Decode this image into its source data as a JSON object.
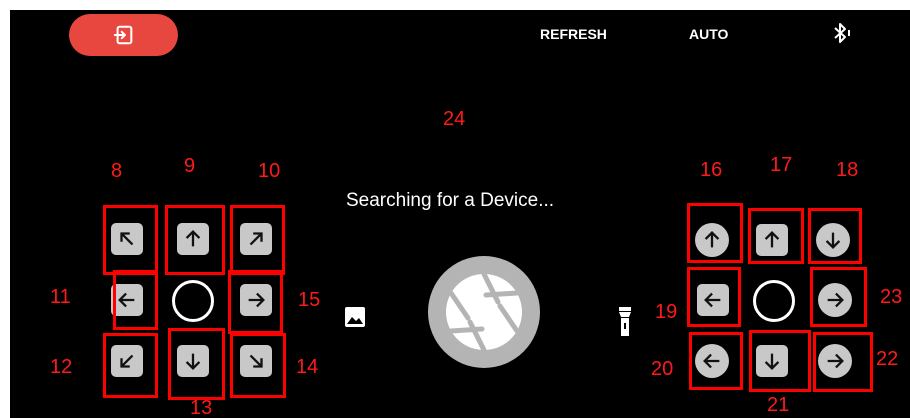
{
  "toolbar": {
    "exit_icon": "exit-icon",
    "refresh_label": "REFRESH",
    "auto_label": "AUTO",
    "bluetooth_icon": "bluetooth-icon"
  },
  "status": {
    "text": "Searching for a Device..."
  },
  "annotations": {
    "n8": "8",
    "n9": "9",
    "n10": "10",
    "n11": "11",
    "n12": "12",
    "n13": "13",
    "n14": "14",
    "n15": "15",
    "n16": "16",
    "n17": "17",
    "n18": "18",
    "n19": "19",
    "n20": "20",
    "n21": "21",
    "n22": "22",
    "n23": "23",
    "n24": "24"
  },
  "colors": {
    "accent": "#e8473f",
    "annotation": "#ff0000",
    "background": "#000000",
    "button": "#c8c8c8"
  }
}
